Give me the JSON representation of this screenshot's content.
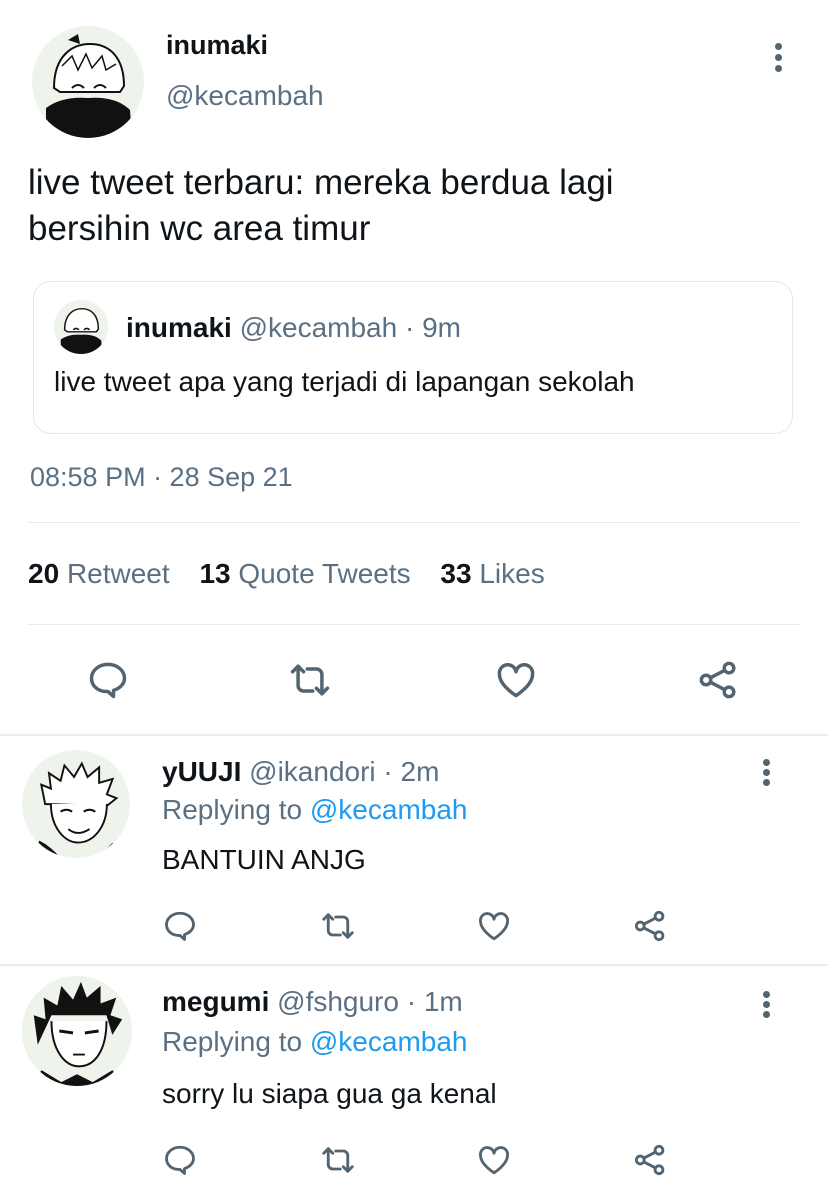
{
  "tweet": {
    "display_name": "inumaki",
    "handle": "@kecambah",
    "text_line1": "live tweet terbaru: mereka berdua lagi",
    "text_line2": "bersihin wc area timur",
    "timestamp": "08:58 PM · 28 Sep 21"
  },
  "quoted": {
    "display_name": "inumaki",
    "handle_time": "@kecambah · 9m",
    "text": "live tweet apa yang terjadi di lapangan sekolah"
  },
  "stats": {
    "retweets_count": "20",
    "retweets_label": "Retweet",
    "quotes_count": "13",
    "quotes_label": "Quote Tweets",
    "likes_count": "33",
    "likes_label": "Likes"
  },
  "replies": [
    {
      "display_name": "yUUJI",
      "handle_time": "@ikandori · 2m",
      "replying_prefix": "Replying to",
      "replying_handle": "@kecambah",
      "text": "BANTUIN ANJG"
    },
    {
      "display_name": "megumi",
      "handle_time": "@fshguro · 1m",
      "replying_prefix": "Replying to",
      "replying_handle": "@kecambah",
      "text": "sorry lu siapa gua ga kenal"
    }
  ],
  "icons": {
    "more": "more-vertical-icon",
    "reply": "reply-icon",
    "retweet": "retweet-icon",
    "like": "heart-icon",
    "share": "share-icon"
  },
  "colors": {
    "text": "#0f1419",
    "muted": "#5b7083",
    "link": "#1d9bf0",
    "divider": "#e6ecf0"
  }
}
